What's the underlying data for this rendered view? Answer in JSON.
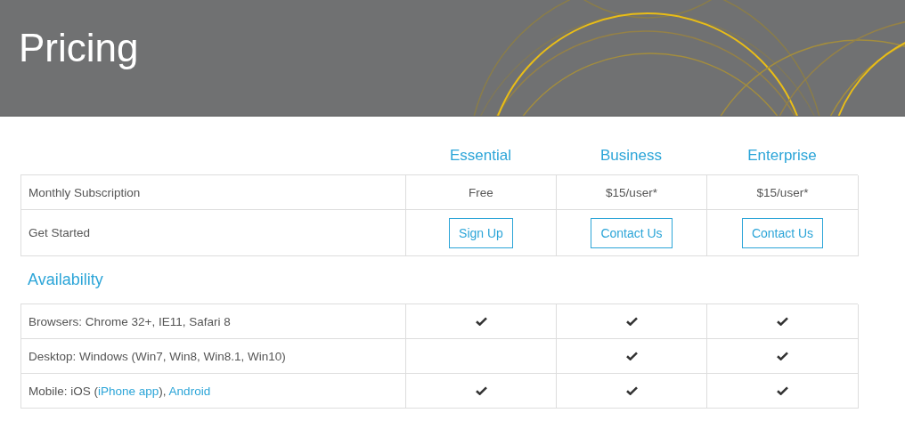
{
  "header": {
    "title": "Pricing"
  },
  "plans": [
    "Essential",
    "Business",
    "Enterprise"
  ],
  "rows": [
    {
      "kind": "text",
      "label": "Monthly Subscription",
      "cells": [
        "Free",
        "$15/user*",
        "$15/user*"
      ]
    },
    {
      "kind": "buttons",
      "label": "Get Started",
      "cells": [
        "Sign Up",
        "Contact Us",
        "Contact Us"
      ]
    }
  ],
  "availability": {
    "title": "Availability",
    "features": [
      {
        "parts": [
          {
            "kind": "text",
            "text": "Browsers: Chrome 32+, IE11, Safari 8"
          }
        ],
        "available": [
          true,
          true,
          true
        ]
      },
      {
        "parts": [
          {
            "kind": "text",
            "text": "Desktop: Windows (Win7, Win8, Win8.1, Win10)"
          }
        ],
        "available": [
          false,
          true,
          true
        ]
      },
      {
        "parts": [
          {
            "kind": "text",
            "text": "Mobile: iOS ("
          },
          {
            "kind": "link",
            "text": "iPhone app"
          },
          {
            "kind": "text",
            "text": "), "
          },
          {
            "kind": "link",
            "text": "Android"
          }
        ],
        "available": [
          true,
          true,
          true
        ]
      }
    ]
  }
}
